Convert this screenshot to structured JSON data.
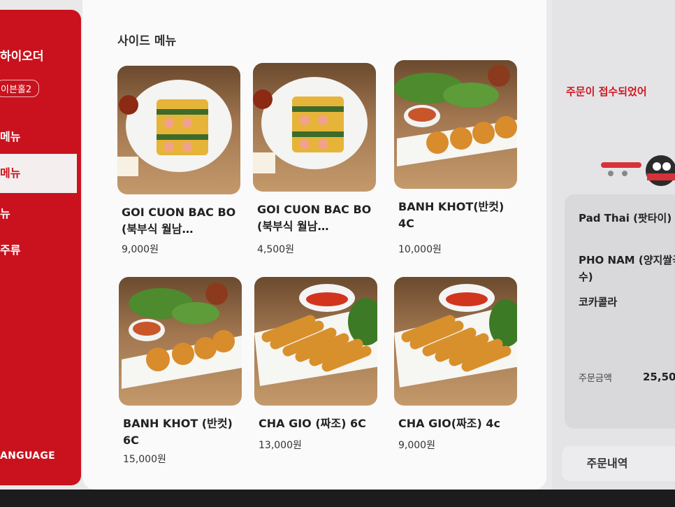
{
  "sidebar": {
    "brand": "하이오더",
    "badge": "이븐홀2",
    "items": [
      {
        "label": "메뉴"
      },
      {
        "label": "메뉴"
      },
      {
        "label": "뉴"
      },
      {
        "label": "주류"
      }
    ],
    "language": "ANGUAGE"
  },
  "main": {
    "section_title": "사이드 메뉴",
    "cards": [
      {
        "name": "GOI CUON BAC BO (북부식 월남…",
        "price": "9,000원",
        "image": "spring-roll-plate-icon"
      },
      {
        "name": "GOI CUON BAC BO (북부식 월남…",
        "price": "4,500원",
        "image": "spring-roll-plate-icon"
      },
      {
        "name": "BANH KHOT(반컷) 4C",
        "price": "10,000원",
        "image": "shrimp-pancake-icon"
      },
      {
        "name": "BANH KHOT (반컷) 6C",
        "price": "15,000원",
        "image": "shrimp-pancake-icon"
      },
      {
        "name": "CHA GIO (짜조) 6C",
        "price": "13,000원",
        "image": "fried-roll-icon"
      },
      {
        "name": "CHA GIO(짜조) 4c",
        "price": "9,000원",
        "image": "fried-roll-icon"
      }
    ]
  },
  "right_panel": {
    "notice": "주문이 접수되었어",
    "order_items": [
      "Pad Thai (팟타이)",
      "PHO NAM (양지쌀국수)",
      "코카콜라"
    ],
    "total_label": "주문금액",
    "total_value": "25,50",
    "history_button": "주문내역"
  },
  "colors": {
    "brand_red": "#c9121e",
    "notice_red": "#d21422"
  }
}
